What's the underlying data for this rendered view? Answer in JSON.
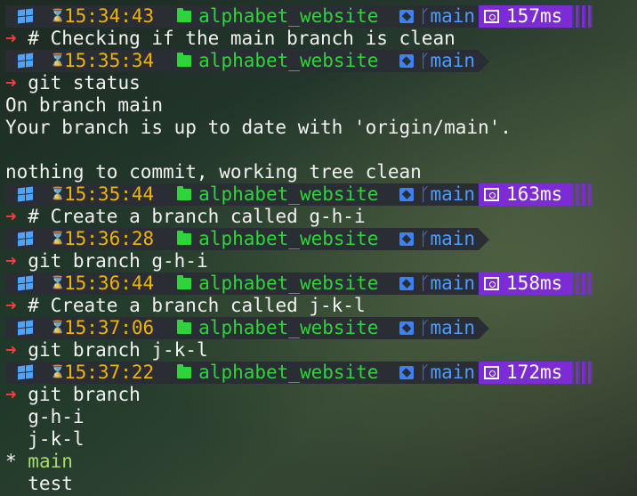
{
  "terminal": {
    "entries": [
      {
        "type": "prompt",
        "time": "15:34:43",
        "dir": "alphabet_website",
        "branch": "main",
        "duration": "157ms"
      },
      {
        "type": "command",
        "arrow": "➜",
        "text": " # Checking if the main branch is clean"
      },
      {
        "type": "prompt",
        "time": "15:35:34",
        "dir": "alphabet_website",
        "branch": "main",
        "duration": ""
      },
      {
        "type": "command",
        "arrow": "➜",
        "text": " git status"
      },
      {
        "type": "output",
        "text": "On branch main"
      },
      {
        "type": "output",
        "text": "Your branch is up to date with 'origin/main'."
      },
      {
        "type": "output",
        "text": ""
      },
      {
        "type": "output",
        "text": "nothing to commit, working tree clean"
      },
      {
        "type": "prompt",
        "time": "15:35:44",
        "dir": "alphabet_website",
        "branch": "main",
        "duration": "163ms"
      },
      {
        "type": "command",
        "arrow": "➜",
        "text": " # Create a branch called g-h-i"
      },
      {
        "type": "prompt",
        "time": "15:36:28",
        "dir": "alphabet_website",
        "branch": "main",
        "duration": ""
      },
      {
        "type": "command",
        "arrow": "➜",
        "text": " git branch g-h-i"
      },
      {
        "type": "prompt",
        "time": "15:36:44",
        "dir": "alphabet_website",
        "branch": "main",
        "duration": "158ms"
      },
      {
        "type": "command",
        "arrow": "➜",
        "text": " # Create a branch called j-k-l"
      },
      {
        "type": "prompt",
        "time": "15:37:06",
        "dir": "alphabet_website",
        "branch": "main",
        "duration": ""
      },
      {
        "type": "command",
        "arrow": "➜",
        "text": " git branch j-k-l"
      },
      {
        "type": "prompt",
        "time": "15:37:22",
        "dir": "alphabet_website",
        "branch": "main",
        "duration": "172ms"
      },
      {
        "type": "command",
        "arrow": "➜",
        "text": " git branch"
      },
      {
        "type": "output",
        "text": "  g-h-i"
      },
      {
        "type": "output",
        "text": "  j-k-l"
      },
      {
        "type": "current-branch",
        "marker": "* ",
        "text": "main"
      },
      {
        "type": "output",
        "text": "  test"
      }
    ]
  },
  "colors": {
    "time": "#f0b400",
    "dir": "#2fd33a",
    "branch": "#4a9cff",
    "duration_bg": "#7d2bd4",
    "arrow": "#ff3b3b",
    "current_branch": "#a8dc6a"
  },
  "icons": {
    "os": "windows-icon",
    "clock": "hourglass-icon",
    "folder": "folder-icon",
    "repo": "git-repo-icon",
    "branch": "git-branch-icon",
    "timer": "timer-icon"
  }
}
